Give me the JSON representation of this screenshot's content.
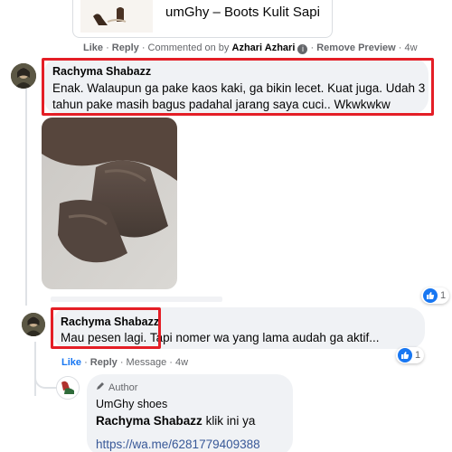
{
  "preview": {
    "title": "umGhy – Boots Kulit Sapi"
  },
  "preview_meta": {
    "like": "Like",
    "reply": "Reply",
    "commented_on_by": "Commented on by",
    "author": "Azhari Azhari",
    "remove_preview": "Remove Preview",
    "time": "4w"
  },
  "comment1": {
    "name": "Rachyma Shabazz",
    "text_line1": "Enak. Walaupun ga pake kaos kaki, ga bikin lecet. Kuat juga. Udah 3",
    "text_line2": "tahun pake masih bagus padahal jarang saya cuci.. Wkwkwkw",
    "reaction_count": "1"
  },
  "comment2": {
    "name": "Rachyma Shabazz",
    "text": "Mau pesen lagi. Tapi nomer wa yang lama audah ga aktif...",
    "reaction_count": "1",
    "like": "Like",
    "reply": "Reply",
    "message": "Message",
    "time": "4w"
  },
  "reply": {
    "badge": "Author",
    "name": "UmGhy shoes",
    "mention": "Rachyma Shabazz",
    "text": "klik ini ya",
    "url": "https://wa.me/6281779409388"
  },
  "colors": {
    "accent": "#1877f2",
    "highlight": "#e41e26",
    "bubble": "#f0f2f5"
  }
}
